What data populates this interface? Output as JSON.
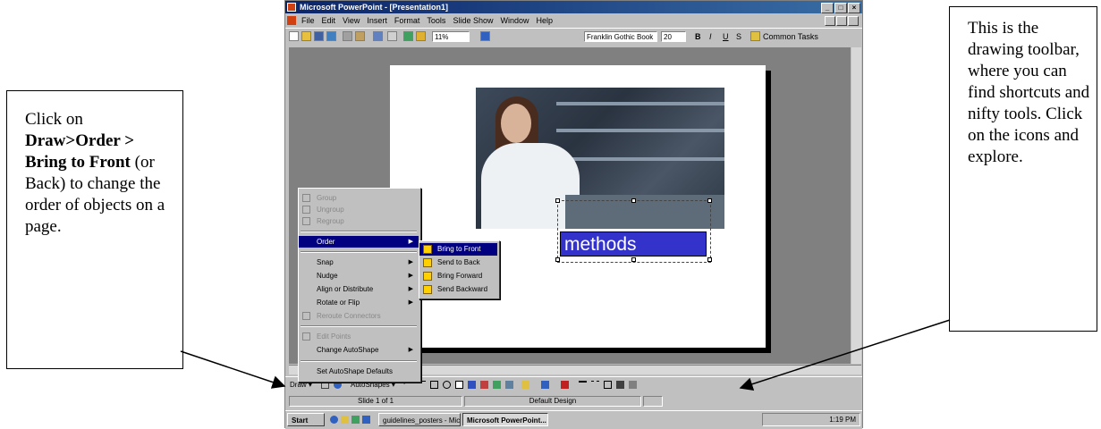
{
  "callouts": {
    "left": {
      "p1": "Click on ",
      "b1": "Draw>Order > Bring to Front",
      "p2": " (or Back) to change the order of objects on a page."
    },
    "right": {
      "text": "This is the drawing toolbar, where you can find shortcuts and nifty tools. Click on the icons and explore."
    }
  },
  "window": {
    "title": "Microsoft PowerPoint - [Presentation1]",
    "menu": [
      "File",
      "Edit",
      "View",
      "Insert",
      "Format",
      "Tools",
      "Slide Show",
      "Window",
      "Help"
    ],
    "zoom": "11%",
    "font": "Franklin Gothic Book",
    "font_size": "20",
    "common_tasks": "Common Tasks"
  },
  "slide": {
    "text_box": "methods"
  },
  "draw_menu": {
    "items": [
      {
        "label": "Group",
        "disabled": true
      },
      {
        "label": "Ungroup",
        "disabled": true
      },
      {
        "label": "Regroup",
        "disabled": true
      },
      {
        "label": "Order",
        "disabled": false,
        "selected": true
      },
      {
        "label": "Snap",
        "disabled": false
      },
      {
        "label": "Nudge",
        "disabled": false
      },
      {
        "label": "Align or Distribute",
        "disabled": false
      },
      {
        "label": "Rotate or Flip",
        "disabled": false
      },
      {
        "label": "Reroute Connectors",
        "disabled": true
      },
      {
        "label": "Edit Points",
        "disabled": true
      },
      {
        "label": "Change AutoShape",
        "disabled": false
      },
      {
        "label": "Set AutoShape Defaults",
        "disabled": false
      }
    ],
    "order_submenu": [
      "Bring to Front",
      "Send to Back",
      "Bring Forward",
      "Send Backward"
    ]
  },
  "drawing_toolbar": {
    "draw": "Draw",
    "autoshapes": "AutoShapes"
  },
  "status_bar": {
    "slide": "Slide 1 of 1",
    "design": "Default Design"
  },
  "taskbar": {
    "start": "Start",
    "task1": "guidelines_posters - Micros...",
    "task2": "Microsoft PowerPoint...",
    "time": "1:19 PM"
  },
  "colors": {
    "title_bar": "#0a246a",
    "selection": "#000080",
    "methods_box": "#3333cc",
    "workspace": "#808080"
  }
}
